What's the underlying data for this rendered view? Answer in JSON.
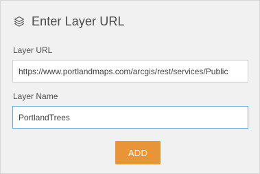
{
  "dialog": {
    "icon": "layers-icon",
    "title": "Enter Layer URL"
  },
  "layer_url": {
    "label": "Layer URL",
    "value": "https://www.portlandmaps.com/arcgis/rest/services/Public"
  },
  "layer_name": {
    "label": "Layer Name",
    "value": "PortlandTrees"
  },
  "actions": {
    "add_label": "ADD",
    "add_color": "#e8953a"
  }
}
